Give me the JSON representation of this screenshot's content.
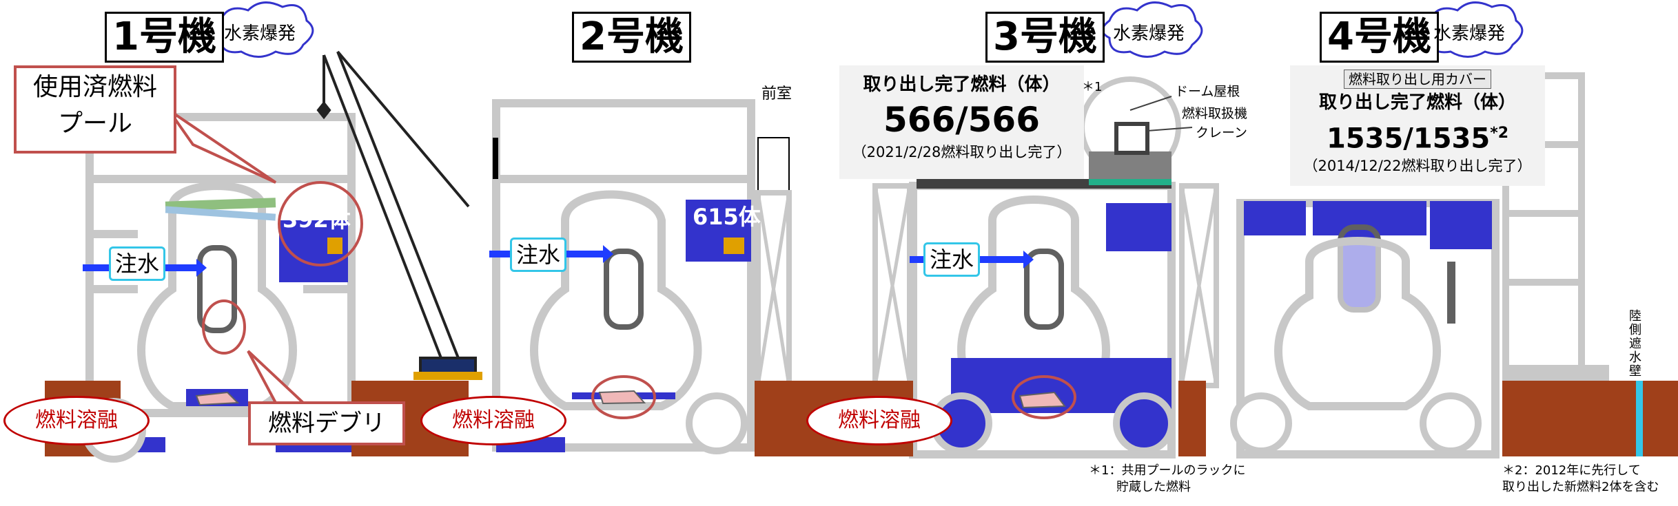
{
  "units": [
    {
      "title": "1号機",
      "event": "水素爆発",
      "pool_count": "392体",
      "injection": "注水",
      "melt": "燃料溶融"
    },
    {
      "title": "2号機",
      "pool_count": "615体",
      "injection": "注水",
      "melt": "燃料溶融",
      "anteroom": "前室"
    },
    {
      "title": "3号機",
      "event": "水素爆発",
      "injection": "注水",
      "melt": "燃料溶融",
      "removed_title": "取り出し完了燃料（体）",
      "removed_mark": "＊1",
      "removed_value": "566/566",
      "removed_date": "（2021/2/28燃料取り出し完了）",
      "dome_roof": "ドーム屋根",
      "fuel_handling": "燃料取扱機",
      "crane": "クレーン",
      "footnote": [
        "＊1：共用プールのラックに",
        "貯蔵した燃料"
      ]
    },
    {
      "title": "4号機",
      "event": "水素爆発",
      "cover": "燃料取り出し用カバー",
      "removed_title": "取り出し完了燃料（体）",
      "removed_value": "1535/1535",
      "removed_mark": "*2",
      "removed_date": "（2014/12/22燃料取り出し完了）",
      "footnote": [
        "＊2：2012年に先行して",
        "取り出した新燃料2体を含む"
      ]
    }
  ],
  "callouts": {
    "spent_pool": [
      "使用済燃料",
      "プール"
    ],
    "debris": "燃料デブリ"
  },
  "seawall": [
    "陸",
    "側",
    "遮",
    "水",
    "壁"
  ],
  "colors": {
    "pool": "#3333cc",
    "soil": "#a0401a",
    "structure": "#c8c8c8",
    "accent_red": "#c00000",
    "cyan": "#33c6e8"
  }
}
